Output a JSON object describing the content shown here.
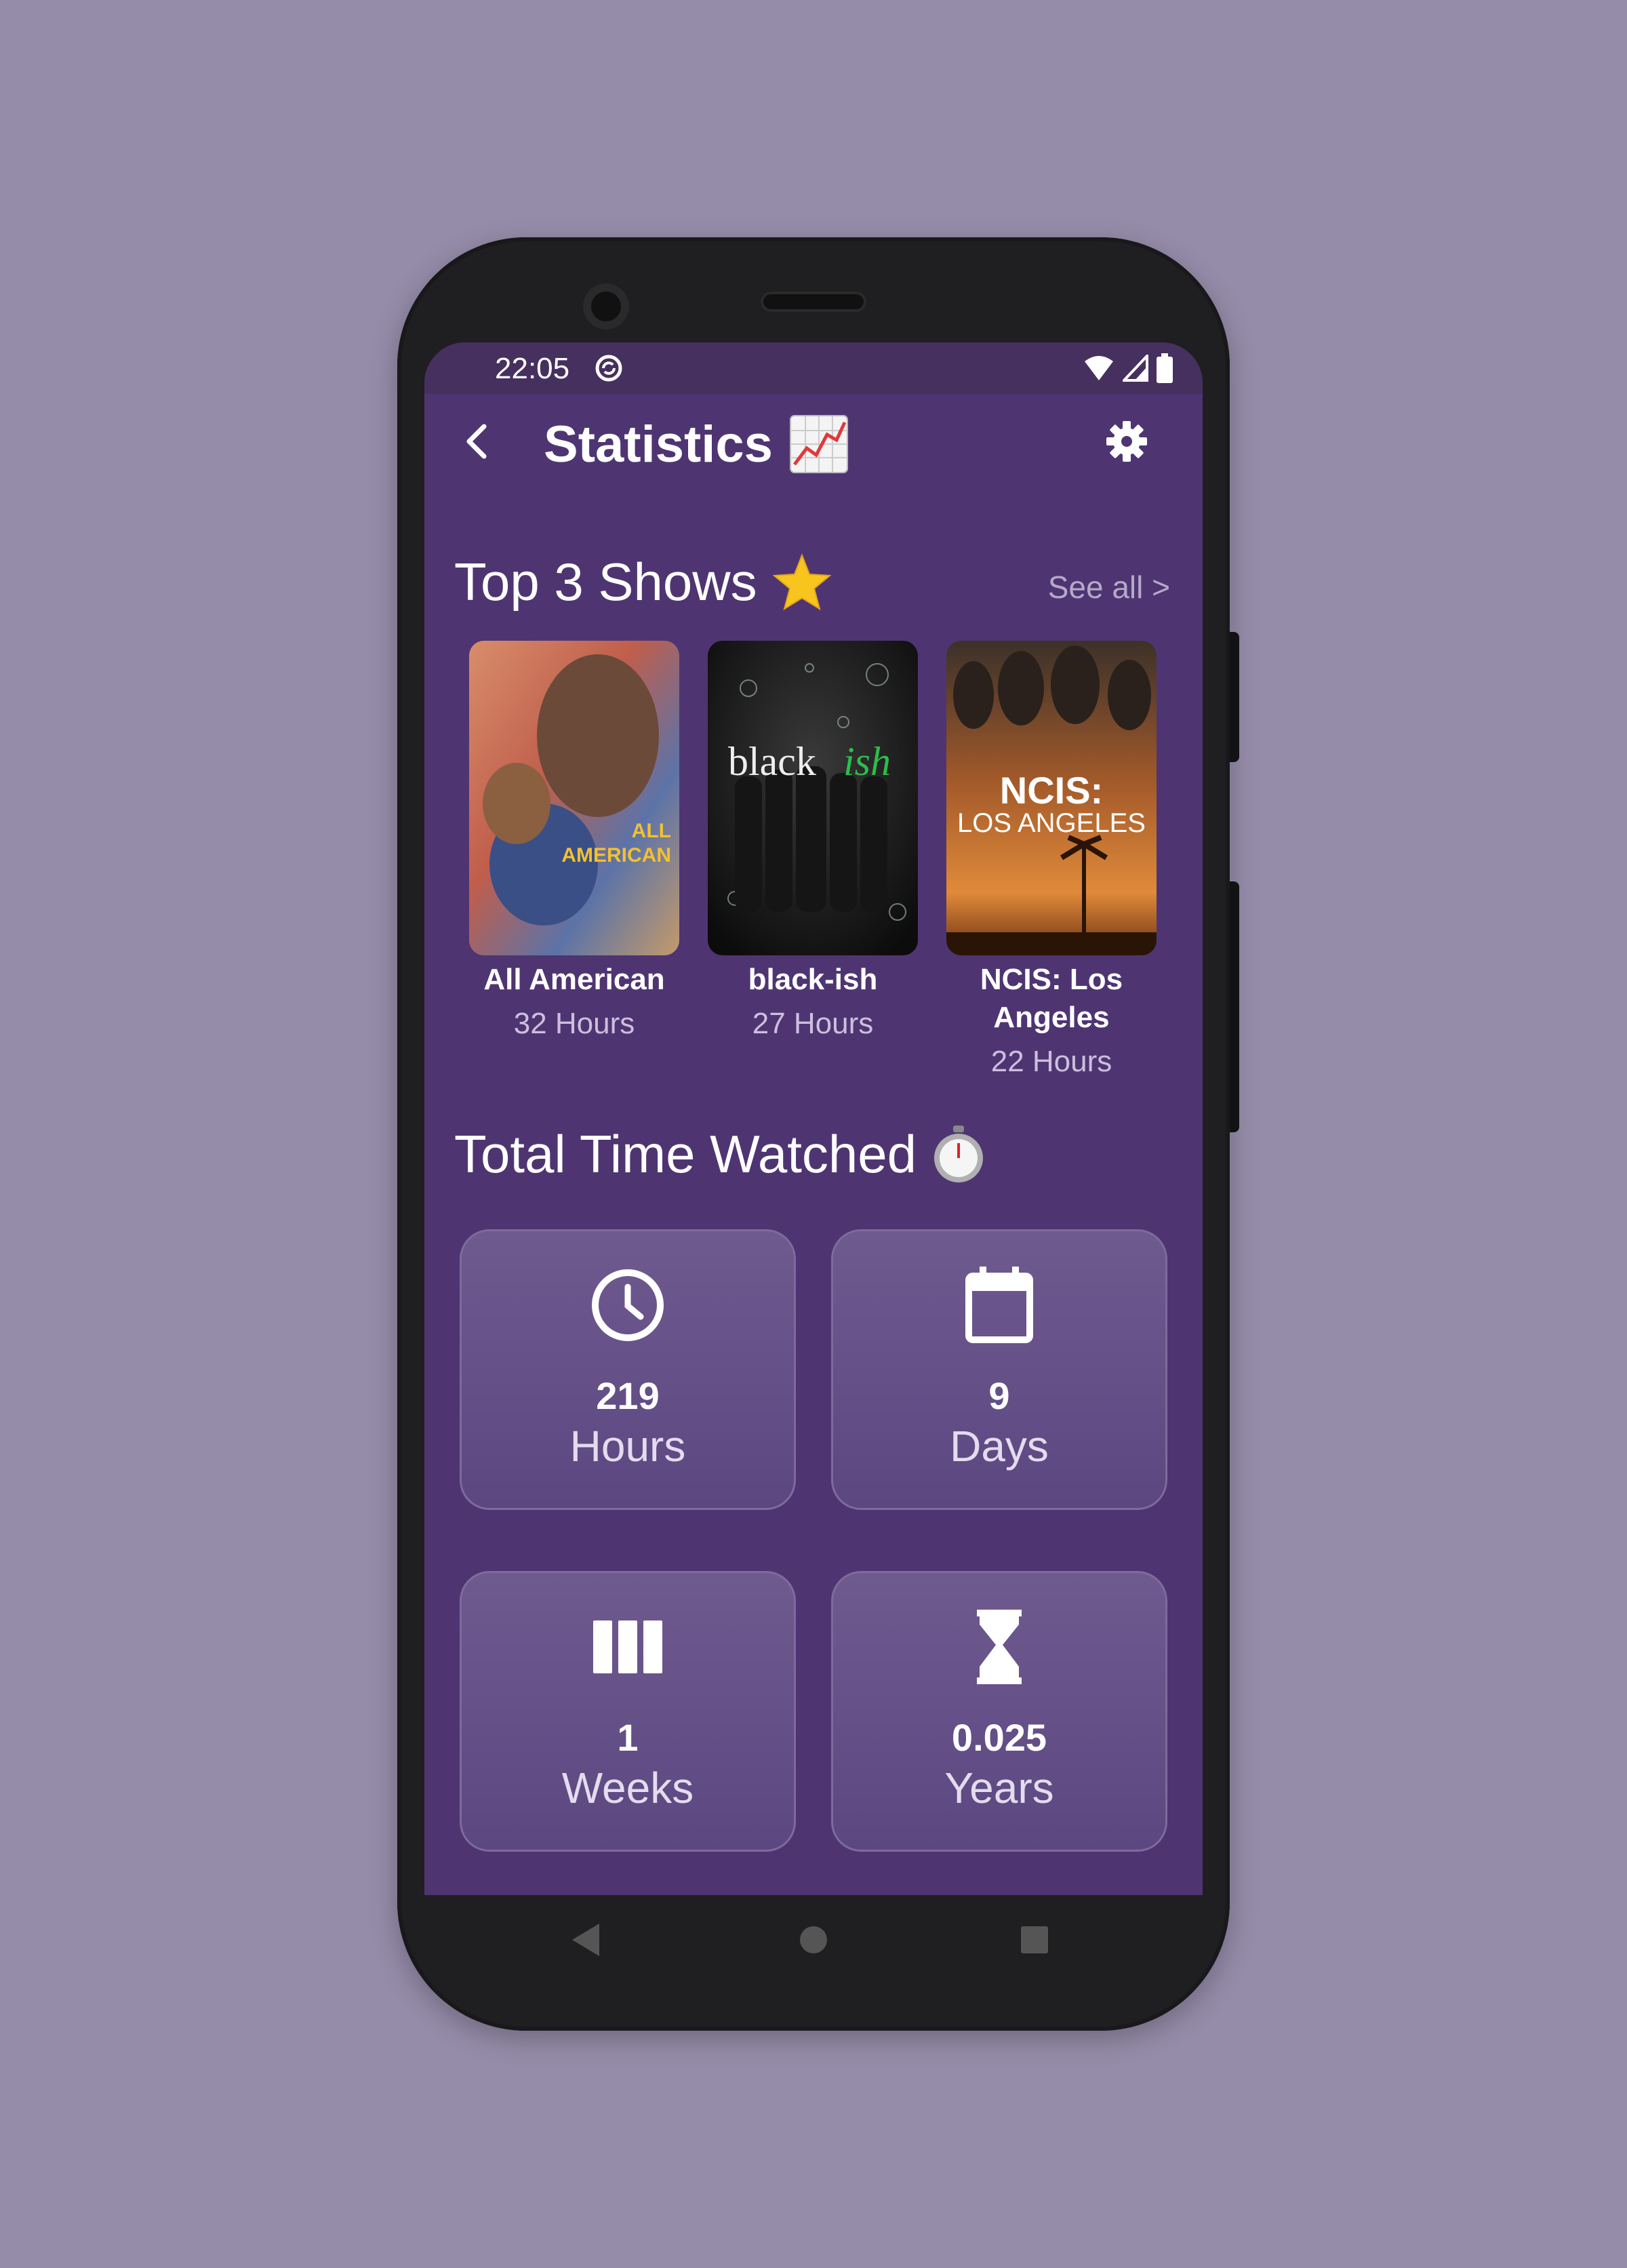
{
  "status_bar": {
    "time": "22:05"
  },
  "app_bar": {
    "title": "Statistics",
    "title_emoji": "📈"
  },
  "top_shows": {
    "heading": "Top 3 Shows",
    "heading_emoji": "⭐",
    "see_all": "See all >",
    "shows": [
      {
        "name": "All American",
        "hours": "32 Hours",
        "poster_text": [
          "ALL",
          "AMERICAN"
        ]
      },
      {
        "name": "black-ish",
        "hours": "27 Hours",
        "poster_text": [
          "black",
          "ish"
        ]
      },
      {
        "name": "NCIS: Los Angeles",
        "name_lines": [
          "NCIS: Los",
          "Angeles"
        ],
        "hours": "22 Hours",
        "poster_text": [
          "NCIS:",
          "LOS ANGELES"
        ]
      }
    ]
  },
  "total_time": {
    "heading": "Total Time Watched",
    "heading_emoji": "⏱️",
    "cards": [
      {
        "value": "219",
        "unit": "Hours",
        "icon": "clock-icon"
      },
      {
        "value": "9",
        "unit": "Days",
        "icon": "calendar-icon"
      },
      {
        "value": "1",
        "unit": "Weeks",
        "icon": "week-columns-icon"
      },
      {
        "value": "0.025",
        "unit": "Years",
        "icon": "hourglass-icon"
      }
    ]
  },
  "colors": {
    "background": "#958ca9",
    "screen": "#4e3572",
    "status_bar": "#46305f",
    "card": "#664f88",
    "accent_text": "#cdbfdd"
  }
}
